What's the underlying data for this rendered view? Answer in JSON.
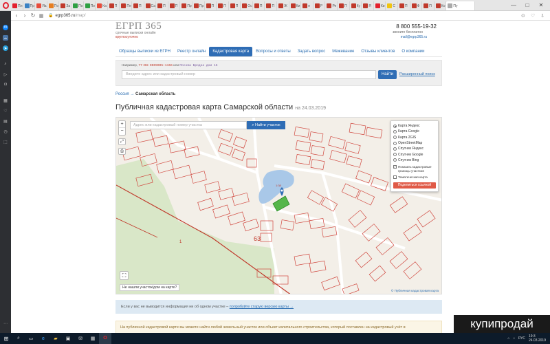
{
  "browser": {
    "tabs": [
      {
        "label": "Пл",
        "color": "#e3202d"
      },
      {
        "label": "Пр",
        "color": "#3b82c4"
      },
      {
        "label": "Яа",
        "color": "#e74c3c"
      },
      {
        "label": "По",
        "color": "#e67e22"
      },
      {
        "label": "За",
        "color": "#c0392b"
      },
      {
        "label": "По",
        "color": "#2ea043"
      },
      {
        "label": "По",
        "color": "#2ea043"
      },
      {
        "label": "Ка",
        "color": "#e74c3c"
      },
      {
        "label": "П",
        "color": "#c0392b"
      },
      {
        "label": "Пе",
        "color": "#c0392b"
      },
      {
        "label": "П",
        "color": "#c0392b"
      },
      {
        "label": "Са",
        "color": "#c0392b"
      },
      {
        "label": "П",
        "color": "#c0392b"
      },
      {
        "label": "П",
        "color": "#c0392b"
      },
      {
        "label": "Пр",
        "color": "#c0392b"
      },
      {
        "label": "Пр",
        "color": "#c0392b"
      },
      {
        "label": "П",
        "color": "#c0392b"
      },
      {
        "label": "П",
        "color": "#c0392b"
      },
      {
        "label": "П",
        "color": "#c0392b"
      },
      {
        "label": "Ос",
        "color": "#c0392b"
      },
      {
        "label": "П",
        "color": "#c0392b"
      },
      {
        "label": "П",
        "color": "#c0392b"
      },
      {
        "label": "Ж",
        "color": "#c0392b"
      },
      {
        "label": "Ки",
        "color": "#c0392b"
      },
      {
        "label": "п",
        "color": "#c0392b"
      },
      {
        "label": "Р",
        "color": "#c0392b"
      },
      {
        "label": "Ре",
        "color": "#c0392b"
      },
      {
        "label": "П",
        "color": "#c0392b"
      },
      {
        "label": "Ку",
        "color": "#c0392b"
      },
      {
        "label": "Я",
        "color": "#c0392b"
      },
      {
        "label": "Ки",
        "color": "#e3202d"
      },
      {
        "label": "С",
        "color": "#f1c40f"
      },
      {
        "label": "П",
        "color": "#c0392b"
      },
      {
        "label": "Ф",
        "color": "#c0392b"
      },
      {
        "label": "П",
        "color": "#c0392b"
      },
      {
        "label": "Ко",
        "color": "#c0392b"
      }
    ],
    "active_tab": "Пу",
    "url_host": "egrp365.ru",
    "url_path": "/map/",
    "window_controls": [
      "—",
      "□",
      "✕"
    ]
  },
  "site": {
    "logo": "ЕГРП 365",
    "logo_sub": "срочные выписки онлайн",
    "logo_tag": "круглосуточно",
    "phone": "8 800 555-19-32",
    "phone_note": "звоните бесплатно",
    "email": "mail@egrp365.ru"
  },
  "nav": [
    {
      "label": "Образцы выписки из ЕГРН",
      "active": false
    },
    {
      "label": "Реестр онлайн",
      "active": false
    },
    {
      "label": "Кадастровая карта",
      "active": true
    },
    {
      "label": "Вопросы и ответы",
      "active": false
    },
    {
      "label": "Задать вопрос",
      "active": false
    },
    {
      "label": "Межевание",
      "active": false
    },
    {
      "label": "Отзывы клиентов",
      "active": false
    },
    {
      "label": "О компании",
      "active": false
    }
  ],
  "search": {
    "example_prefix": "Например,",
    "example_code": "77:08:0009005:1156",
    "example_or": "или",
    "example_address": "Москва Бродна дом 16",
    "placeholder": "Введите адрес или кадастровый номер",
    "button": "Найти",
    "advanced": "Расширенный поиск"
  },
  "breadcrumb": {
    "root": "Россия",
    "sep": "→",
    "current": "Самарская область"
  },
  "title": {
    "text": "Публичная кадастровая карта Самарской области",
    "date": "на 24.03.2019"
  },
  "map": {
    "zoom_in": "+",
    "zoom_out": "−",
    "input_placeholder": "Адрес или кадастровый номер участка",
    "find_button": "Найти участок",
    "layers": [
      "Карта Яндекс",
      "Карта Google",
      "Карта 2GIS",
      "OpenStreetMap",
      "Спутник Яндекс",
      "Спутник Google",
      "Спутник Bing"
    ],
    "selected_layer": "Карта Яндекс",
    "check_boundaries": "Показать кадастровые границы участков",
    "check_thematic": "Тематическая карта",
    "share_button": "Поделиться ссылкой",
    "not_found": "Не нашли участок/дом на карте?",
    "attribution": "© Публичная кадастровая карта",
    "label_63": "63",
    "label_1": "1",
    "label_small": "1:38"
  },
  "info": {
    "text": "Если у вас не выводится информация ни об одном участке –",
    "link": "попробуйте старую версию карты →",
    "notice": "На публичной кадастровой карте вы можете найти любой земельный участок или объект капитального строительства, который поставлен на кадастровый учёт в"
  },
  "watermark": "купипродай",
  "taskbar": {
    "time": "19:3",
    "date": "24.03.2019",
    "lang": "РУС"
  }
}
